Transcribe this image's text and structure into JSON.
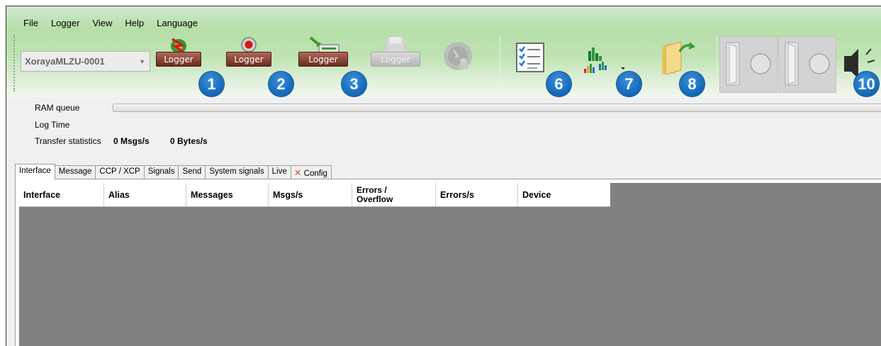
{
  "menu": [
    "File",
    "Logger",
    "View",
    "Help",
    "Language"
  ],
  "device": {
    "selected": "XorayaMLZU-0001"
  },
  "toolbar": {
    "logger_labels": [
      "Logger",
      "Logger",
      "Logger",
      "Logger"
    ],
    "badges": [
      "1",
      "2",
      "3",
      "6",
      "7",
      "8",
      "10"
    ]
  },
  "status": {
    "ram_queue_label": "RAM queue",
    "log_time_label": "Log Time",
    "transfer_label": "Transfer statistics",
    "msgs_rate": "0 Msgs/s",
    "bytes_rate": "0 Bytes/s",
    "ram_queue_fill": 0
  },
  "tabs": [
    "Interface",
    "Message",
    "CCP / XCP",
    "Signals",
    "Send",
    "System signals",
    "Live",
    "Config"
  ],
  "active_tab": "Interface",
  "grid": {
    "columns": [
      "Interface",
      "Alias",
      "Messages",
      "Msgs/s",
      "Errors / Overflow",
      "Errors/s",
      "Device"
    ],
    "rows": []
  },
  "colors": {
    "toolbar_green": "#b6dfa8",
    "badge_blue": "#1167b8",
    "logger_brown": "#8a3d2e",
    "grid_gray": "#818181"
  }
}
